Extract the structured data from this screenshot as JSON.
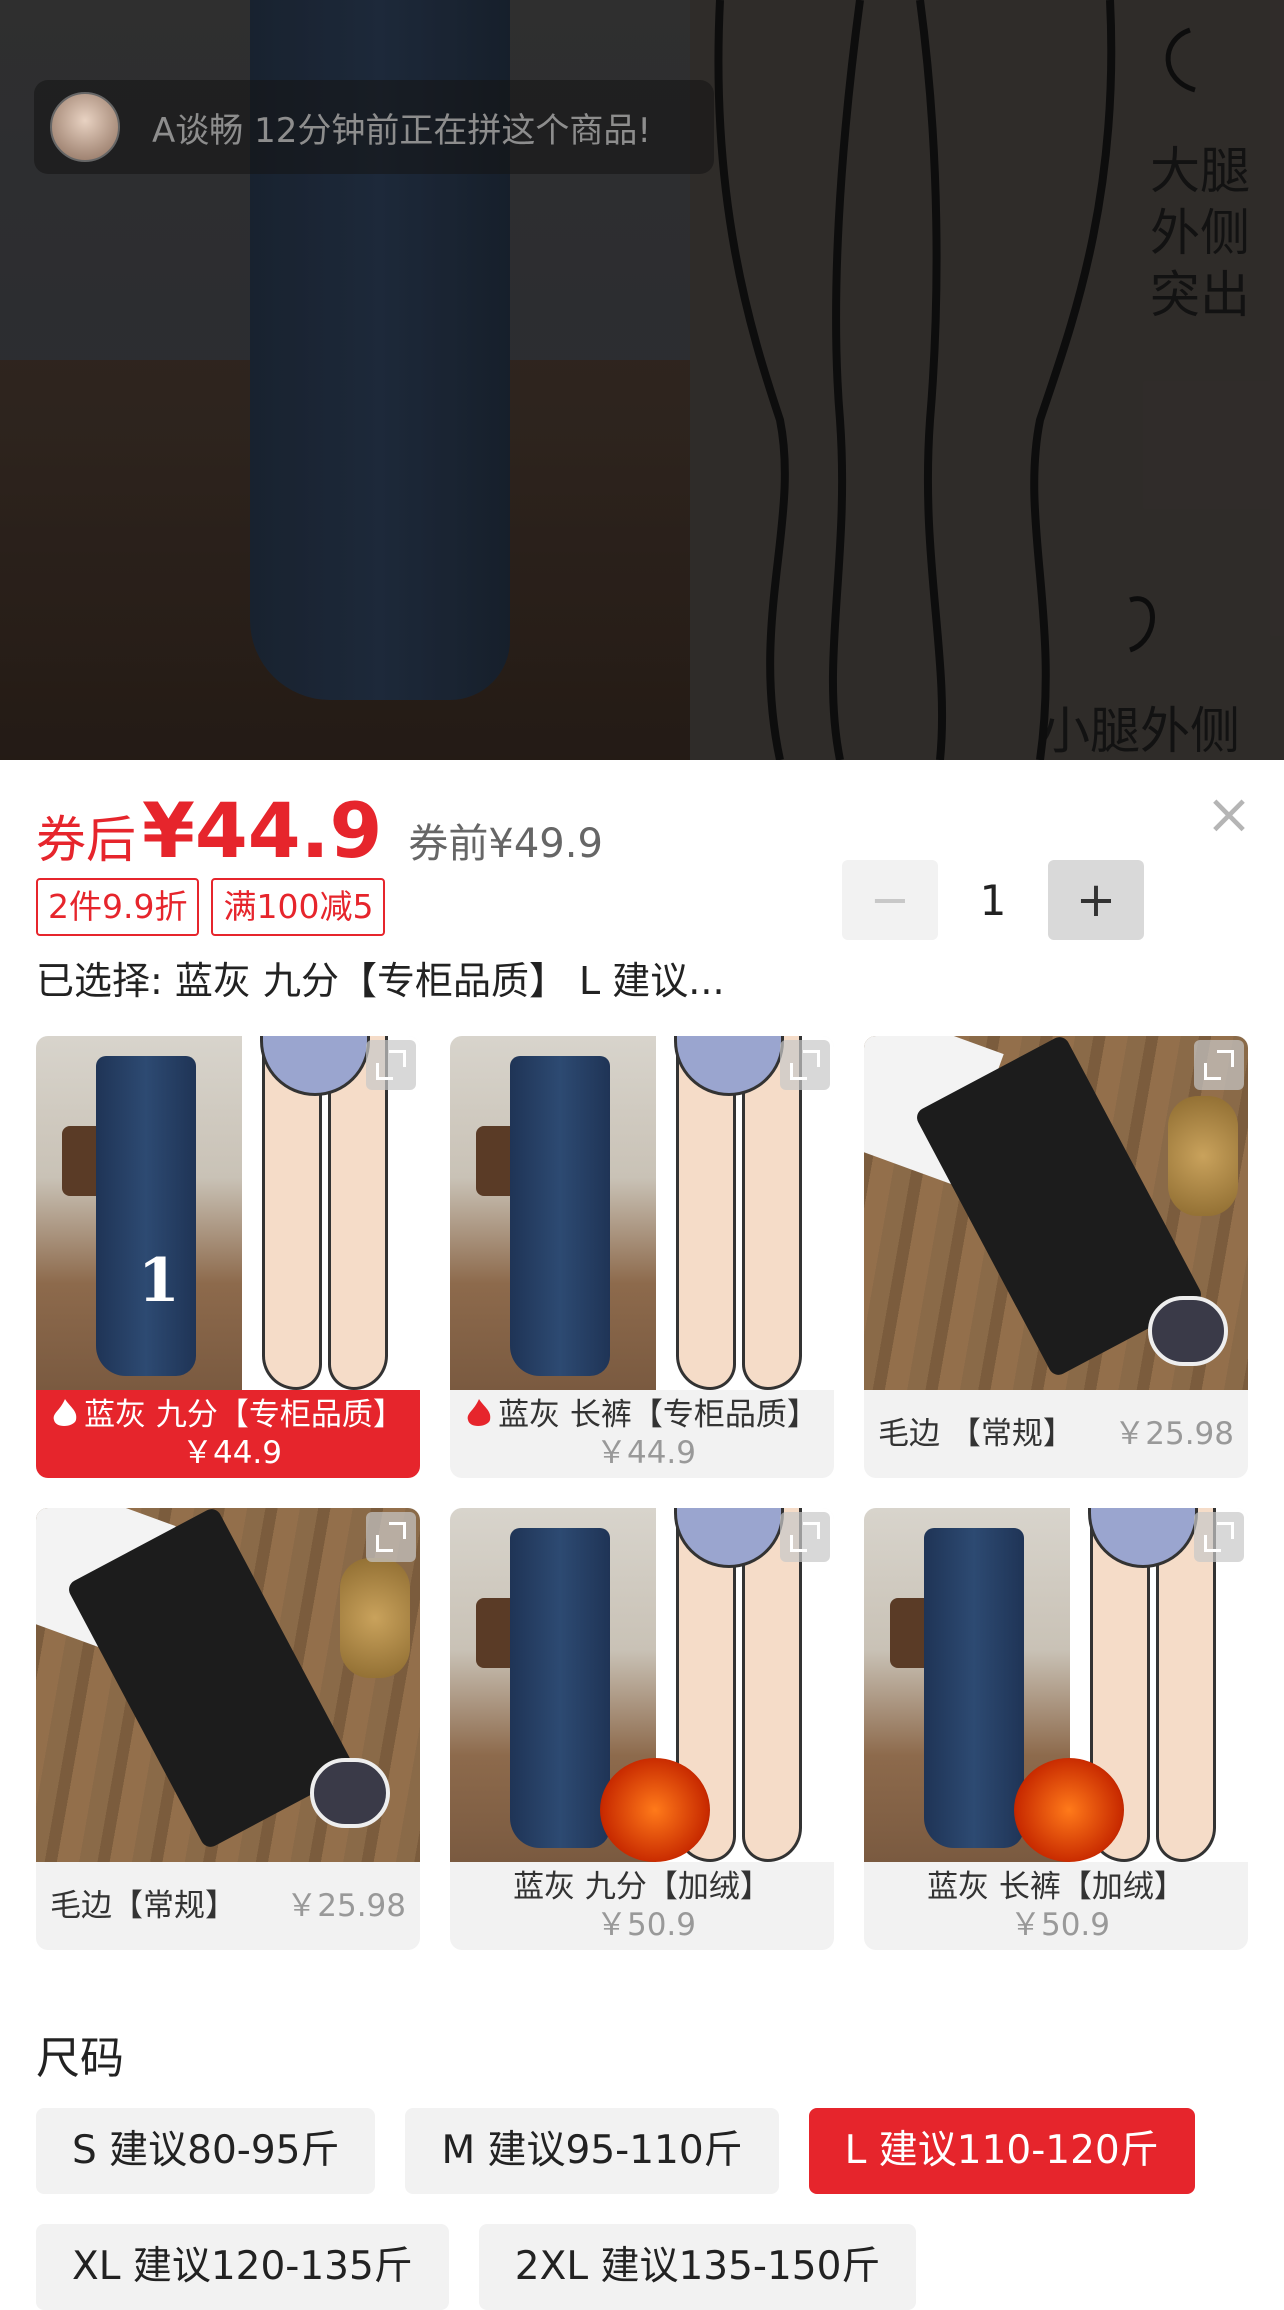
{
  "toast": {
    "text": "A谈畅 12分钟前正在拼这个商品!"
  },
  "backdrop": {
    "note_top": "大腿\n外侧\n突出",
    "note_bottom": "小腿外侧"
  },
  "price": {
    "label": "券后",
    "value": "¥44.9",
    "original": "券前¥49.9"
  },
  "promos": [
    "2件9.9折",
    "满100减5"
  ],
  "quantity": {
    "minus": "−",
    "value": "1",
    "plus": "+"
  },
  "close": "×",
  "selected": "已选择: 蓝灰 九分【专柜品质】 L 建议...",
  "variants": [
    {
      "name": "蓝灰 九分【专柜品质】",
      "price": "￥44.9",
      "selected": true,
      "hot": true,
      "number": "1"
    },
    {
      "name": "蓝灰 长裤【专柜品质】",
      "price": "￥44.9",
      "selected": false,
      "hot": true
    },
    {
      "name": "毛边 【常规】",
      "price": "￥25.98",
      "selected": false
    },
    {
      "name": "毛边【常规】",
      "price": "￥25.98",
      "selected": false
    },
    {
      "name": "蓝灰 九分【加绒】",
      "price": "￥50.9",
      "selected": false
    },
    {
      "name": "蓝灰 长裤【加绒】",
      "price": "￥50.9",
      "selected": false
    }
  ],
  "size": {
    "title": "尺码",
    "options": [
      {
        "label": "S 建议80-95斤",
        "selected": false
      },
      {
        "label": "M 建议95-110斤",
        "selected": false
      },
      {
        "label": "L 建议110-120斤",
        "selected": true
      },
      {
        "label": "XL 建议120-135斤",
        "selected": false
      },
      {
        "label": "2XL 建议135-150斤",
        "selected": false
      }
    ]
  },
  "colors": {
    "accent": "#e6252c",
    "chip_bg": "#f2f2f2"
  }
}
